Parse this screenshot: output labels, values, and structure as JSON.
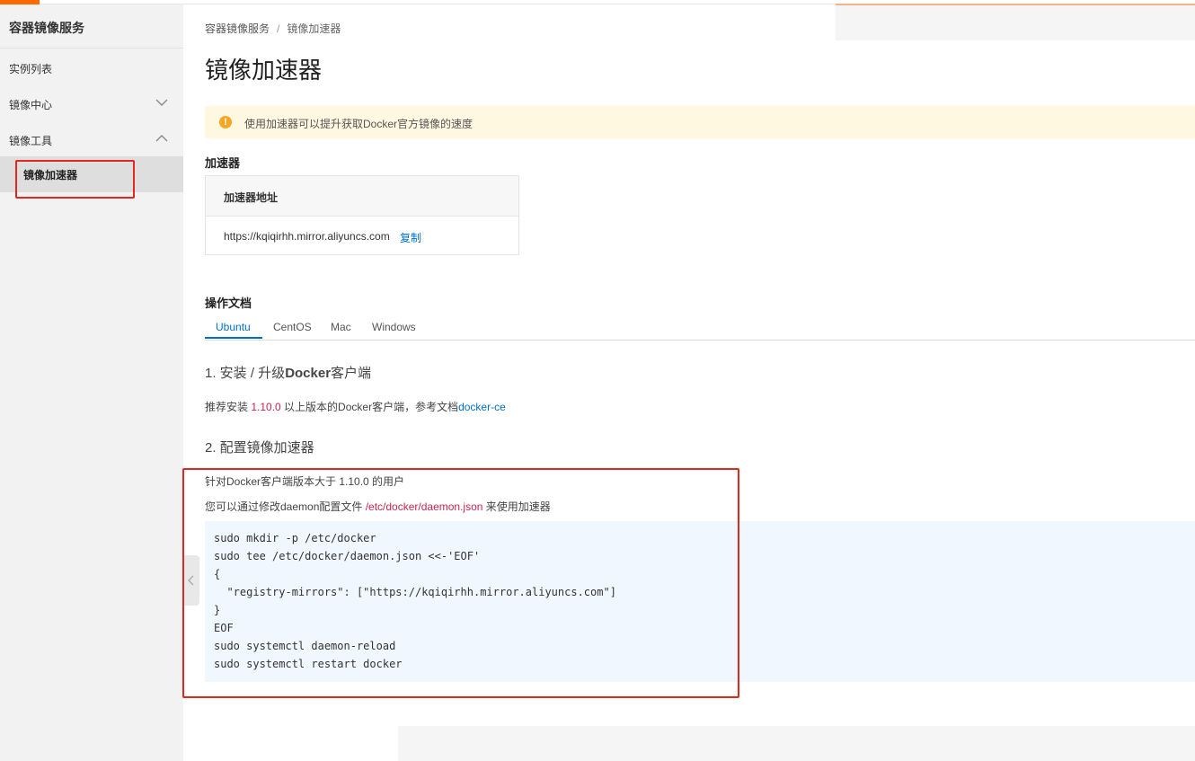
{
  "sidebar": {
    "title": "容器镜像服务",
    "items": [
      {
        "label": "实例列表"
      },
      {
        "label": "镜像中心",
        "chevron": "chevron-down-icon"
      },
      {
        "label": "镜像工具",
        "chevron": "chevron-up-icon"
      },
      {
        "label": "镜像加速器",
        "selected": true
      }
    ]
  },
  "breadcrumb": {
    "root": "容器镜像服务",
    "separator": "/",
    "current": "镜像加速器"
  },
  "page_title": "镜像加速器",
  "notice": {
    "icon": "warning-icon",
    "text": "使用加速器可以提升获取Docker官方镜像的速度"
  },
  "accelerator": {
    "section_title": "加速器",
    "column_header": "加速器地址",
    "url": "https://kqiqirhh.mirror.aliyuncs.com",
    "copy_label": "复制"
  },
  "docs": {
    "section_title": "操作文档",
    "tabs": [
      "Ubuntu",
      "CentOS",
      "Mac",
      "Windows"
    ],
    "active_tab": "Ubuntu",
    "step1": {
      "title_prefix": "1. 安装 / 升级",
      "title_bold": "Docker",
      "title_suffix": "客户端",
      "text_before": "推荐安装 ",
      "version": "1.10.0",
      "text_mid": " 以上版本的Docker客户端，参考文档",
      "link": "docker-ce"
    },
    "step2": {
      "title": "2. 配置镜像加速器",
      "line1": "针对Docker客户端版本大于 1.10.0 的用户",
      "line2_before": "您可以通过修改daemon配置文件 ",
      "line2_path": "/etc/docker/daemon.json",
      "line2_after": " 来使用加速器",
      "code": [
        "sudo mkdir -p /etc/docker",
        "sudo tee /etc/docker/daemon.json <<-'EOF'",
        "{",
        "  \"registry-mirrors\": [\"https://kqiqirhh.mirror.aliyuncs.com\"]",
        "}",
        "EOF",
        "sudo systemctl daemon-reload",
        "sudo systemctl restart docker"
      ]
    }
  },
  "colors": {
    "brand": "#ff6a00",
    "link": "#0070cc",
    "highlight": "#e0281e",
    "code_bg": "#f0f7ff",
    "notice_bg": "#fff8e1"
  }
}
